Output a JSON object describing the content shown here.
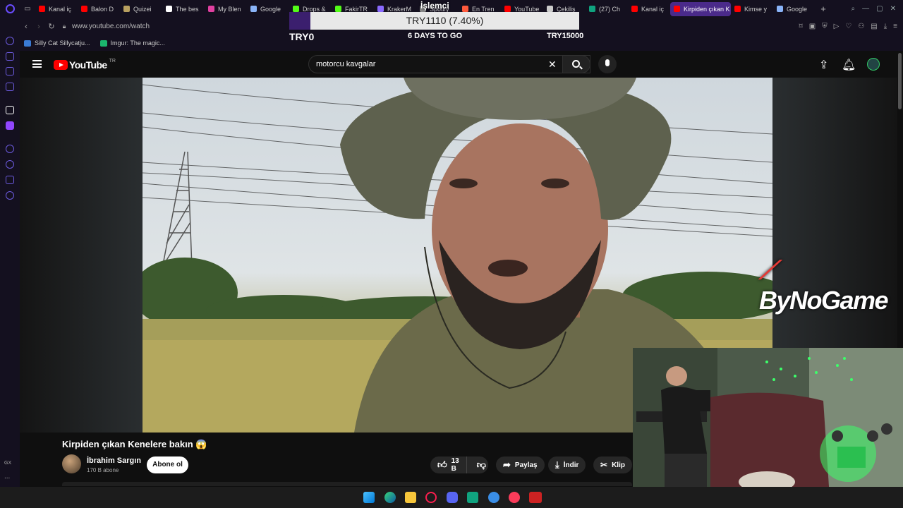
{
  "browser": {
    "tabs": [
      {
        "label": "Kanal iç",
        "color": "#ff0000"
      },
      {
        "label": "Balon D",
        "color": "#ff0000"
      },
      {
        "label": "Quizei",
        "color": "#b8a060"
      },
      {
        "label": "The bes",
        "color": "#ffffff"
      },
      {
        "label": "My Blen",
        "color": "#e040a0"
      },
      {
        "label": "Google",
        "color": "#8ab4f8"
      },
      {
        "label": "Drops &",
        "color": "#53fc18"
      },
      {
        "label": "FakirTR",
        "color": "#53fc18"
      },
      {
        "label": "KrakerM",
        "color": "#8a6aff"
      },
      {
        "label": "Spotify",
        "color": "#888888"
      },
      {
        "label": "En Tren",
        "color": "#ff5a3c"
      },
      {
        "label": "YouTube",
        "color": "#ff0000"
      },
      {
        "label": "Çekiliş",
        "color": "#cccccc"
      },
      {
        "label": "(27) Ch",
        "color": "#10a37f"
      },
      {
        "label": "Kanal iç",
        "color": "#ff0000"
      },
      {
        "label": "Kirpiden çıkan K",
        "color": "#ff0000",
        "active": true
      },
      {
        "label": "Kimse y",
        "color": "#ff0000"
      },
      {
        "label": "Google",
        "color": "#8ab4f8"
      }
    ],
    "new_tab": "+",
    "url": "www.youtube.com/watch",
    "bookmarks": [
      {
        "label": "Silly Cat Sillycatju...",
        "color": "#3a7bd5"
      },
      {
        "label": "Imgur: The magic...",
        "color": "#1bb76e"
      }
    ],
    "sidebar_bottom": "GX",
    "sidebar_more": "..."
  },
  "overlay": {
    "title": "İşlemci",
    "currency_left": "TRY0",
    "progress_text": "TRY1110 (7.40%)",
    "days_left": "6 DAYS TO GO",
    "goal": "TRY15000"
  },
  "youtube": {
    "logo_word": "YouTube",
    "country": "TR",
    "search_value": "motorcu kavgalar",
    "clear_symbol": "✕",
    "video_title": "Kirpiden çıkan Kenelere bakın",
    "title_emoji": "😱",
    "channel_name": "İbrahim Sargın",
    "subscribers": "170 B abone",
    "subscribe_label": "Abone ol",
    "likes": "13 B",
    "share_label": "Paylaş",
    "download_label": "İndir",
    "clip_label": "Klip"
  },
  "watermark": {
    "text": "ByNoGame"
  },
  "colors": {
    "accent": "#6a4cff",
    "youtube_red": "#ff0000",
    "webcam_green": "#3cff6a"
  }
}
